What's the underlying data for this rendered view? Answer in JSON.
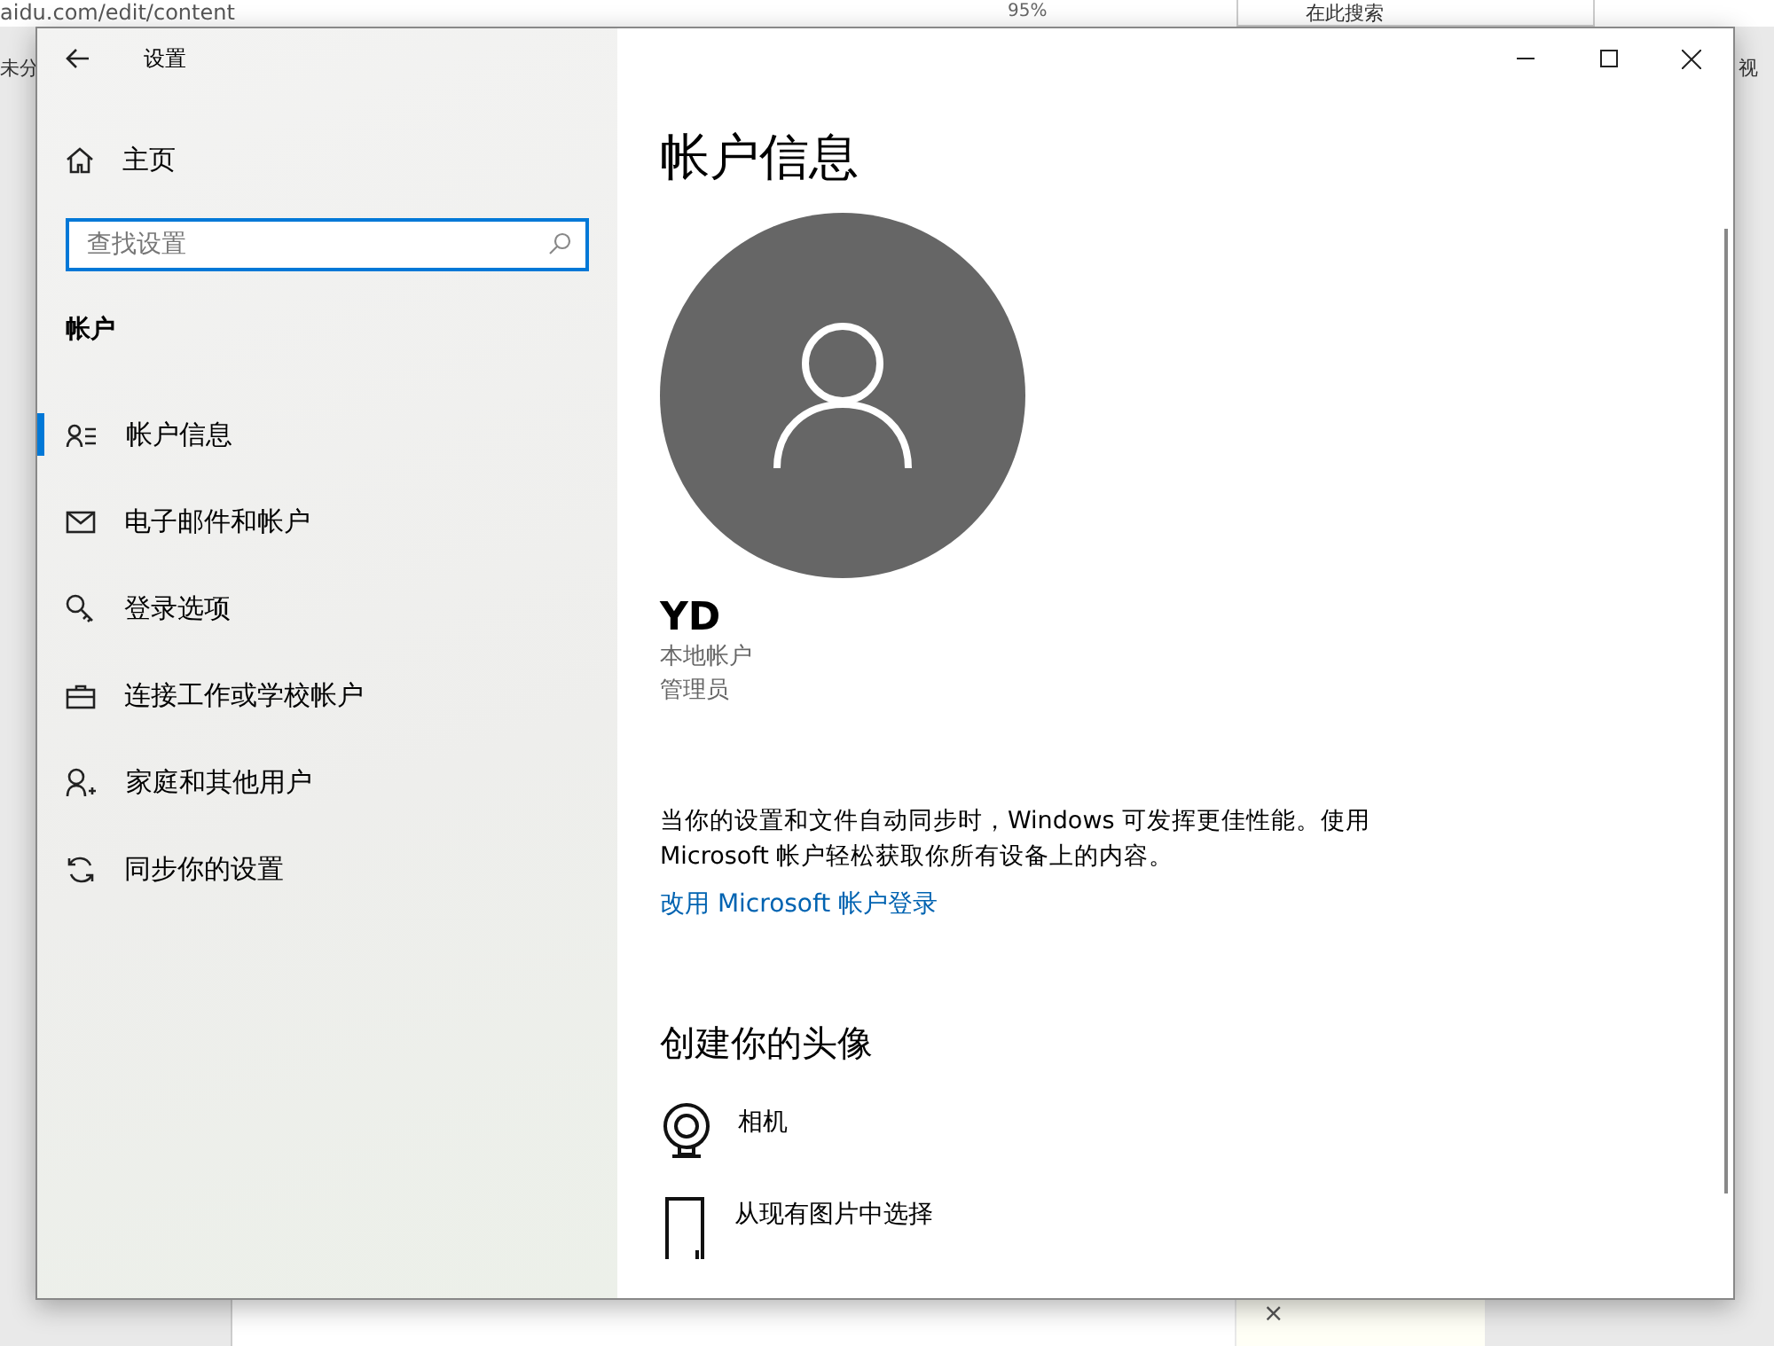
{
  "browser": {
    "url": "aidu.com/edit/content",
    "zoom": "95%",
    "search_placeholder": "在此搜索",
    "left_text": "未分",
    "right_text": "视",
    "close_glyph": "×"
  },
  "window": {
    "title": "设置"
  },
  "sidebar": {
    "home": "主页",
    "search": {
      "placeholder": "查找设置"
    },
    "section": "帐户",
    "items": [
      {
        "kind": "info",
        "label": "帐户信息",
        "selected": true
      },
      {
        "kind": "mail",
        "label": "电子邮件和帐户",
        "selected": false
      },
      {
        "kind": "key",
        "label": "登录选项",
        "selected": false
      },
      {
        "kind": "work",
        "label": "连接工作或学校帐户",
        "selected": false
      },
      {
        "kind": "family",
        "label": "家庭和其他用户",
        "selected": false
      },
      {
        "kind": "sync",
        "label": "同步你的设置",
        "selected": false
      }
    ]
  },
  "main": {
    "heading": "帐户信息",
    "user": "YD",
    "account_type": "本地帐户",
    "role": "管理员",
    "description": "当你的设置和文件自动同步时，Windows 可发挥更佳性能。使用 Microsoft 帐户轻松获取你所有设备上的内容。",
    "link": "改用 Microsoft 帐户登录",
    "avatar_heading": "创建你的头像",
    "avatar_options": [
      {
        "kind": "camera",
        "label": "相机"
      },
      {
        "kind": "browse",
        "label": "从现有图片中选择"
      }
    ]
  }
}
